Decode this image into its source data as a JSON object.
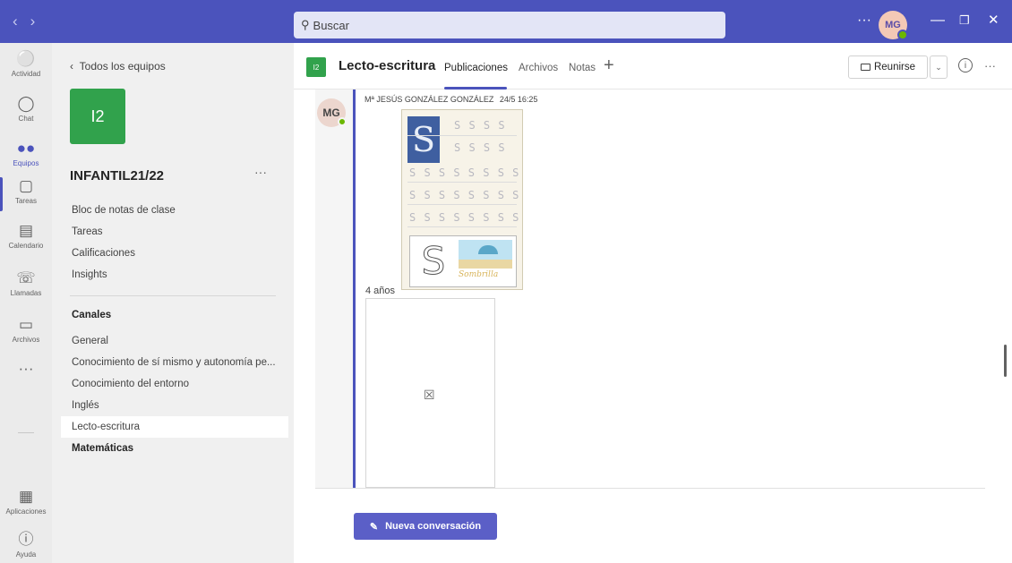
{
  "titlebar": {
    "search_placeholder": "Buscar",
    "avatar_initials": "MG"
  },
  "rail": {
    "items": [
      {
        "label": "Actividad",
        "icon": "bell-icon"
      },
      {
        "label": "Chat",
        "icon": "chat-icon"
      },
      {
        "label": "Equipos",
        "icon": "teams-icon"
      },
      {
        "label": "Tareas",
        "icon": "assignments-icon"
      },
      {
        "label": "Calendario",
        "icon": "calendar-icon"
      },
      {
        "label": "Llamadas",
        "icon": "phone-icon"
      },
      {
        "label": "Archivos",
        "icon": "file-icon"
      }
    ],
    "bottom": [
      {
        "label": "Aplicaciones",
        "icon": "apps-icon"
      },
      {
        "label": "Ayuda",
        "icon": "help-icon"
      }
    ]
  },
  "team_panel": {
    "back_label": "Todos los equipos",
    "team_initials": "I2",
    "team_name": "INFANTIL21/22",
    "menu": [
      "Bloc de notas de clase",
      "Tareas",
      "Calificaciones",
      "Insights"
    ],
    "channels_header": "Canales",
    "channels": [
      "General",
      "Conocimiento de sí mismo y autonomía pe...",
      "Conocimiento del entorno",
      "Inglés",
      "Lecto-escritura",
      "Matemáticas"
    ]
  },
  "header": {
    "channel_initials": "I2",
    "channel_name": "Lecto-escritura",
    "tabs": [
      "Publicaciones",
      "Archivos",
      "Notas"
    ],
    "meet_label": "Reunirse"
  },
  "post": {
    "avatar_initials": "MG",
    "author": "Mª JESÚS GONZÁLEZ GONZÁLEZ",
    "time": "24/5 16:25",
    "worksheet": {
      "big_letter": "S",
      "short_rows": [
        "S S S S",
        "S S S S"
      ],
      "long_rows": [
        "S S S S S S S S",
        "S S S S S S S S",
        "S S S S S S S S"
      ],
      "picture_word": "Sombrilla"
    },
    "caption": "4 años"
  },
  "compose": {
    "new_conversation": "Nueva conversación"
  },
  "colors": {
    "brand": "#4b53bc",
    "button": "#5b5fc7",
    "team_tile": "#31a24c",
    "presence": "#6bb700"
  }
}
